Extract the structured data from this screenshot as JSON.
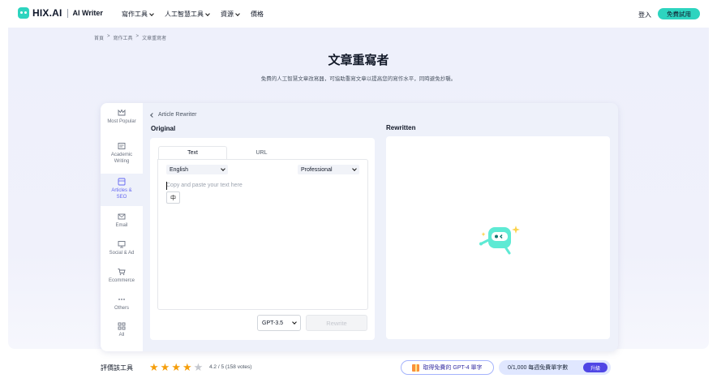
{
  "nav": {
    "logo_text": "HIX.AI",
    "logo_sub": "AI Writer",
    "menu": [
      "寫作工具",
      "人工智慧工具",
      "資源",
      "價格"
    ],
    "login": "登入",
    "trial": "免費試用"
  },
  "breadcrumb": [
    "首頁",
    ">",
    "寫作工具",
    ">",
    "文章重寫者"
  ],
  "hero": {
    "title": "文章重寫者",
    "subtitle": "免費的人工智慧文章改寫器，可協助重寫文章以提高您的寫作水平，同時避免抄襲。"
  },
  "sidebar": [
    {
      "label": "Most Popular",
      "icon": "crown-icon"
    },
    {
      "label": "Academic Writing",
      "icon": "academic-icon"
    },
    {
      "label": "Articles & SEO",
      "icon": "article-icon",
      "active": true
    },
    {
      "label": "Email",
      "icon": "email-icon"
    },
    {
      "label": "Social & Ad",
      "icon": "social-icon"
    },
    {
      "label": "Ecommerce",
      "icon": "cart-icon"
    },
    {
      "label": "Others",
      "icon": "more-icon"
    },
    {
      "label": "All",
      "icon": "grid-icon"
    }
  ],
  "tool": {
    "back_label": "Article Rewriter",
    "original_label": "Original",
    "rewritten_label": "Rewritten",
    "tabs": [
      "Text",
      "URL"
    ],
    "language": "English",
    "style": "Professional",
    "placeholder": "Copy and paste your text here",
    "ime_char": "中",
    "model": "GPT-3.5",
    "rewrite_label": "Rewrite"
  },
  "rating": {
    "label": "評價該工具",
    "value_text": "4.2 / 5 (158 votes)",
    "stars_filled": 4,
    "stars_total": 5
  },
  "promo": {
    "gpt4_text": "取得免費的 GPT-4 單字",
    "quota_text": "0/1,000 每週免費單字數",
    "upgrade": "升級"
  },
  "colors": {
    "accent": "#2dd4bf",
    "primary": "#4f46e5",
    "star": "#f59e0b"
  }
}
